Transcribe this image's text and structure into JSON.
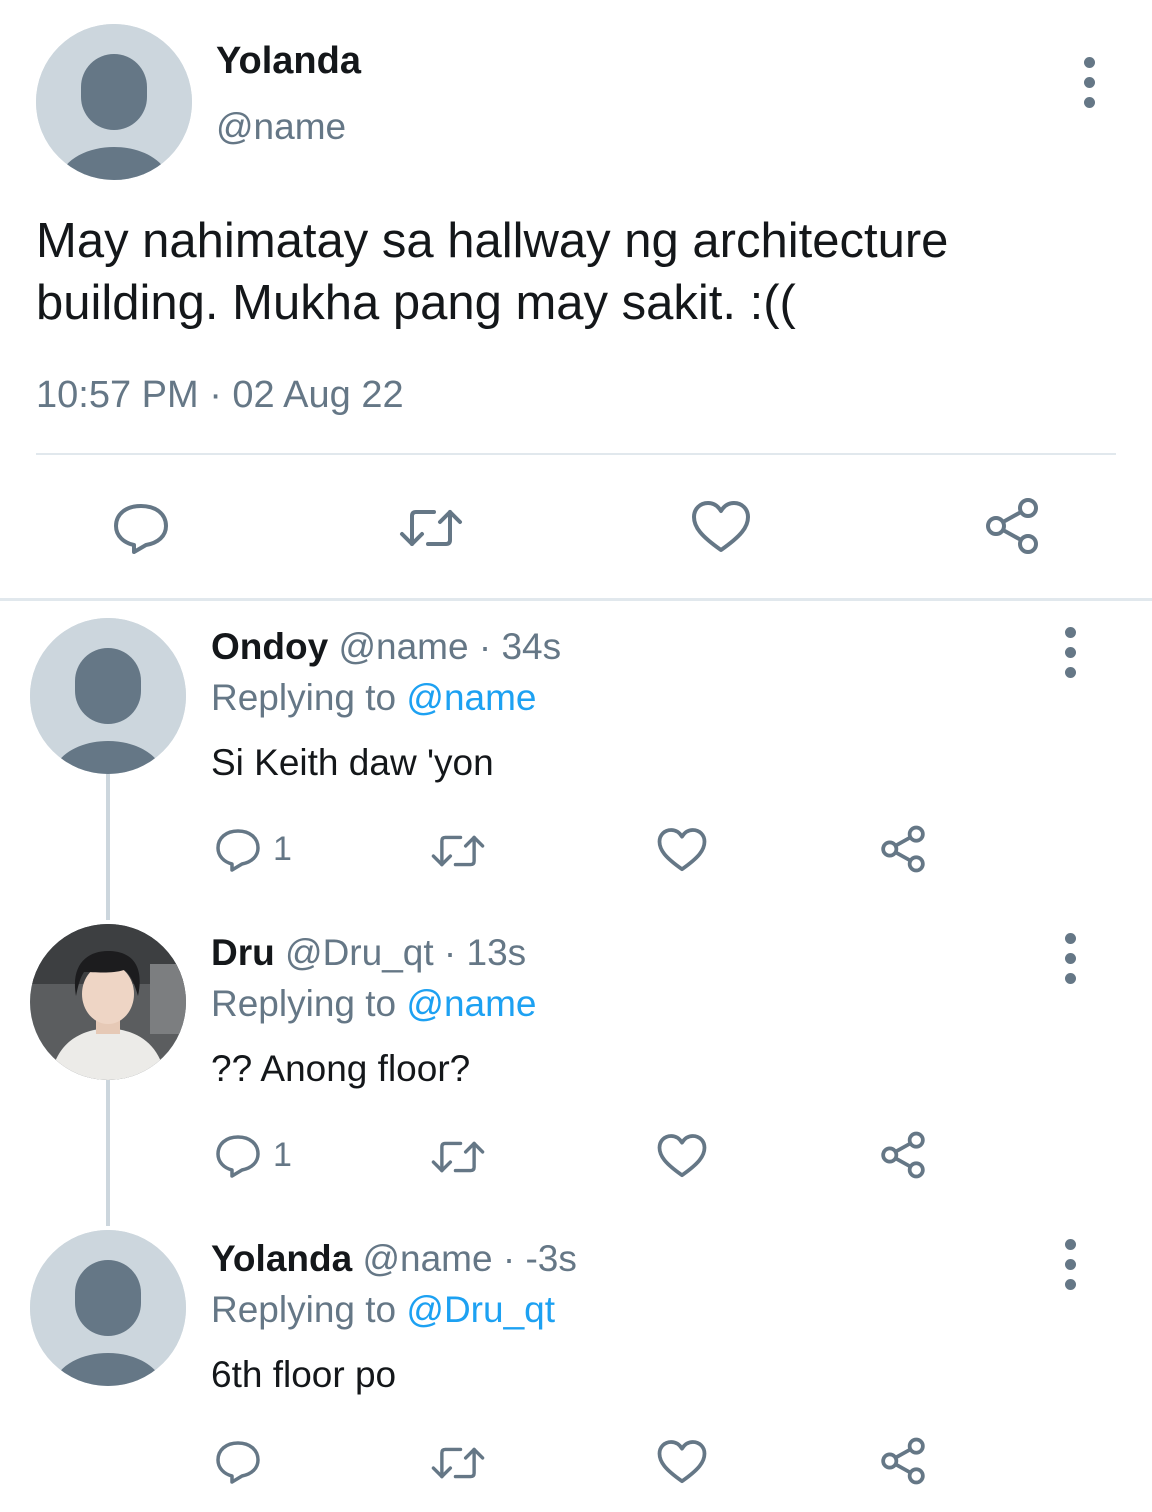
{
  "main_tweet": {
    "name": "Yolanda",
    "handle": "@name",
    "text_line1": "May nahimatay sa hallway ng architecture",
    "text_line2": "building. Mukha pang may sakit. :((",
    "timestamp": "10:57 PM · 02 Aug 22"
  },
  "replies": [
    {
      "name": "Ondoy",
      "meta": "@name · 34s",
      "replying_prefix": "Replying to",
      "replying_to": "@name",
      "text": "Si Keith daw 'yon",
      "reply_count": "1"
    },
    {
      "name": "Dru",
      "meta": "@Dru_qt · 13s",
      "replying_prefix": "Replying to",
      "replying_to": "@name",
      "text": "?? Anong floor?",
      "reply_count": "1"
    },
    {
      "name": "Yolanda",
      "meta": "@name · -3s",
      "replying_prefix": "Replying to",
      "replying_to": "@Dru_qt",
      "text": "6th floor po",
      "reply_count": ""
    }
  ],
  "colors": {
    "accent": "#1da1f2",
    "secondary_text": "#657786",
    "avatar_bg": "#ccd6dd",
    "avatar_fg": "#657786",
    "divider": "#e1e8ed"
  },
  "icons": [
    "reply-icon",
    "retweet-icon",
    "like-icon",
    "share-icon",
    "more-options-icon",
    "default-avatar-icon",
    "photo-avatar-icon"
  ]
}
